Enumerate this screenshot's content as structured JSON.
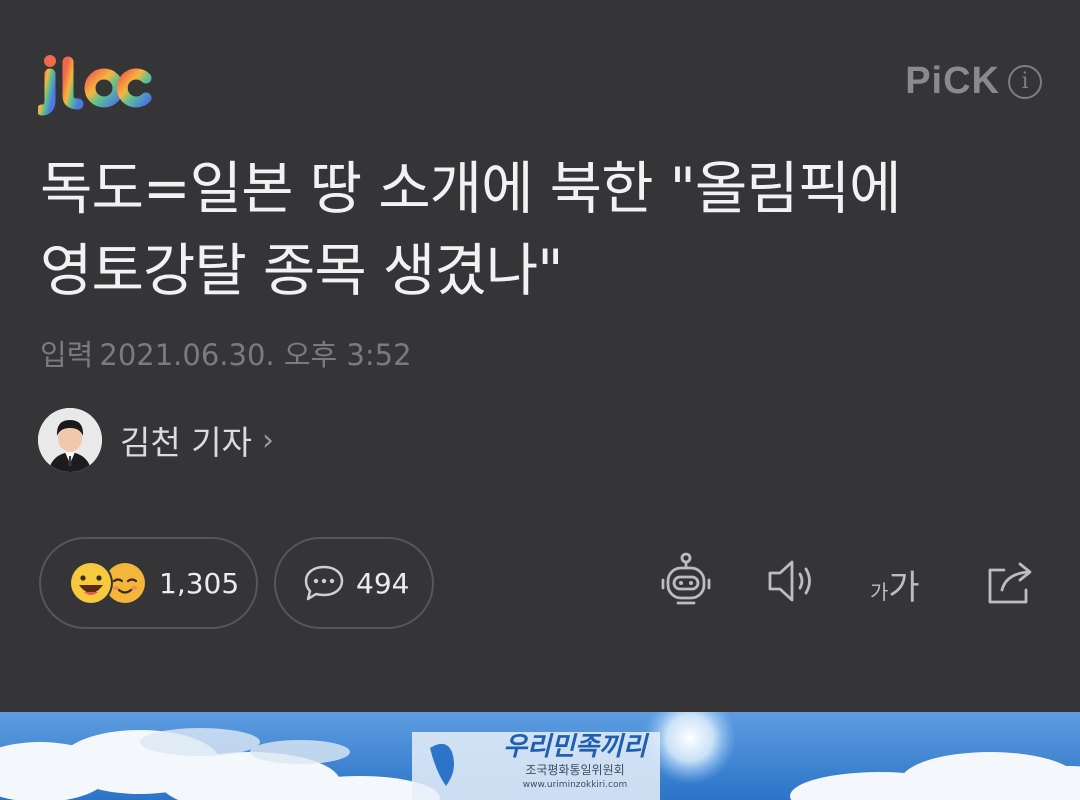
{
  "header": {
    "logo_text": "jtbc",
    "pick_label": "PiCK",
    "pick_info_glyph": "i"
  },
  "article": {
    "headline_line1": "독도=일본 땅 소개에 북한 \"올림픽에",
    "headline_line2": "영토강탈 종목 생겼나\"",
    "date_label": "입력",
    "date_value": "2021.06.30. 오후 3:52",
    "reporter_name": "김천 기자",
    "reporter_chevron": "›"
  },
  "engagement": {
    "reaction_count": "1,305",
    "comment_count": "494"
  },
  "toolbar": {
    "icons": [
      "robot-summary-icon",
      "speaker-icon",
      "font-size-icon",
      "share-icon"
    ],
    "font_size_small": "가",
    "font_size_large": "가"
  },
  "image": {
    "caption_text": "우리민족끼리",
    "caption_sub": "조국평화통일위원회",
    "caption_url": "www.uriminzokkiri.com"
  },
  "colors": {
    "background": "#353538",
    "headline": "#f2f2f2",
    "muted": "#7b7b7f",
    "pill_border": "#57575b",
    "sky": "#3f86d6"
  }
}
